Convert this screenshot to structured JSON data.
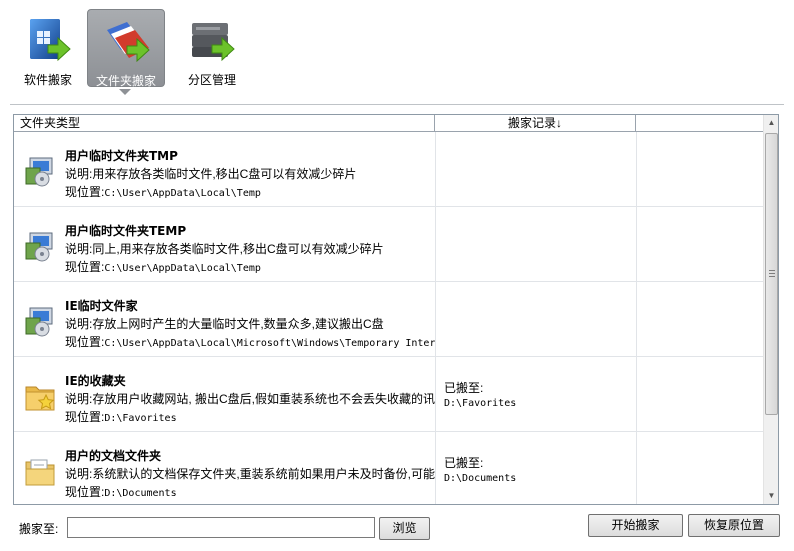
{
  "toolbar": {
    "items": [
      {
        "label": "软件搬家",
        "icon": "windows-box-icon"
      },
      {
        "label": "文件夹搬家",
        "icon": "folders-move-icon"
      },
      {
        "label": "分区管理",
        "icon": "disk-drive-icon"
      }
    ],
    "active_index": 1
  },
  "table": {
    "columns": [
      "文件夹类型",
      "搬家记录↓",
      ""
    ],
    "rows": [
      {
        "icon": "installer-package-icon",
        "title": "用户临时文件夹TMP",
        "desc": "说明:用来存放各类临时文件,移出C盘可以有效减少碎片",
        "loc_label": "现位置:",
        "loc_path": "C:\\User\\AppData\\Local\\Temp",
        "moved_label": "",
        "moved_path": ""
      },
      {
        "icon": "installer-package-icon",
        "title": "用户临时文件夹TEMP",
        "desc": "说明:同上,用来存放各类临时文件,移出C盘可以有效减少碎片",
        "loc_label": "现位置:",
        "loc_path": "C:\\User\\AppData\\Local\\Temp",
        "moved_label": "",
        "moved_path": ""
      },
      {
        "icon": "installer-package-icon",
        "title": "IE临时文件家",
        "desc": "说明:存放上网时产生的大量临时文件,数量众多,建议搬出C盘",
        "loc_label": "现位置:",
        "loc_path": "C:\\User\\AppData\\Local\\Microsoft\\Windows\\Temporary Inter",
        "moved_label": "",
        "moved_path": ""
      },
      {
        "icon": "favorites-folder-icon",
        "title": "IE的收藏夹",
        "desc": "说明:存放用户收藏网站, 搬出C盘后,假如重装系统也不会丢失收藏的讯",
        "loc_label": "现位置:",
        "loc_path": "D:\\Favorites",
        "moved_label": "已搬至:",
        "moved_path": "D:\\Favorites"
      },
      {
        "icon": "documents-folder-icon",
        "title": "用户的文档文件夹",
        "desc": "说明:系统默认的文档保存文件夹,重装系统前如果用户未及时备份,可能",
        "loc_label": "现位置:",
        "loc_path": "D:\\Documents",
        "moved_label": "已搬至:",
        "moved_path": "D:\\Documents"
      }
    ]
  },
  "bottom": {
    "move_to_label": "搬家至:",
    "path_value": "",
    "browse_label": "浏览",
    "start_label": "开始搬家",
    "restore_label": "恢复原位置"
  }
}
